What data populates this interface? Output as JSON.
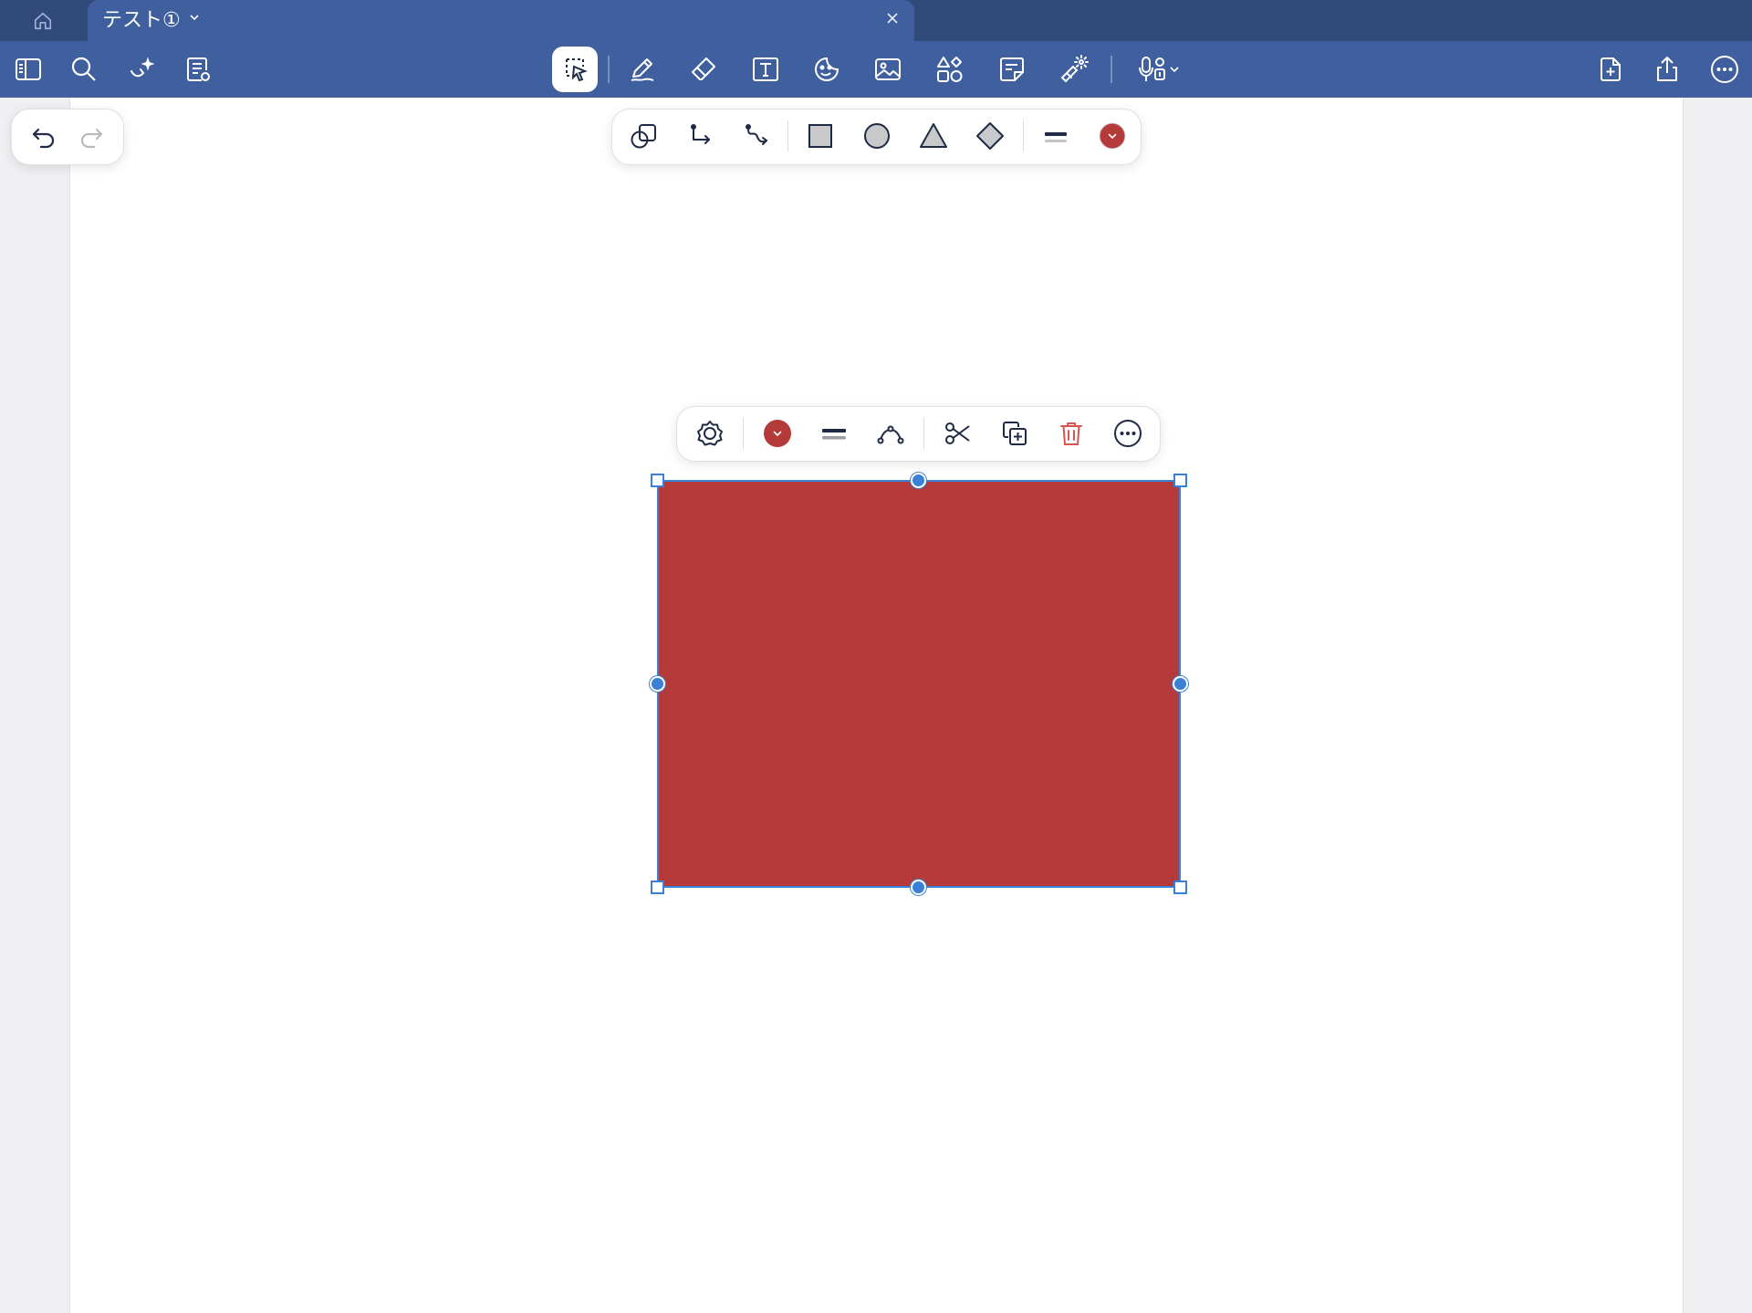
{
  "tab": {
    "title": "テスト①"
  },
  "colors": {
    "header_dark": "#32497b",
    "header": "#3f5f9e",
    "shape_fill": "#b53b3a",
    "selection": "#3a80d6",
    "delete": "#d9534f"
  },
  "toolbar": {
    "left": [
      "sidebar-icon",
      "search-icon",
      "ai-assist-icon",
      "note-settings-icon"
    ],
    "center": [
      "lasso-select-icon",
      "pen-icon",
      "eraser-icon",
      "text-box-icon",
      "sticker-icon",
      "image-icon",
      "shapes-icon",
      "sticky-note-icon",
      "laser-pointer-icon",
      "microphone-icon"
    ],
    "right": [
      "add-page-icon",
      "share-icon",
      "more-icon"
    ]
  },
  "shape_toolbar": {
    "tools": [
      "shape-recognition-icon",
      "elbow-connector-icon",
      "curved-connector-icon",
      "square-icon",
      "circle-icon",
      "triangle-icon",
      "diamond-icon",
      "line-weight-icon",
      "color-picker-icon"
    ],
    "selected_color": "#b53b3a"
  },
  "context_menu": {
    "items": [
      "shape-settings-icon",
      "fill-color-icon",
      "line-weight-icon",
      "edit-points-icon",
      "cut-icon",
      "duplicate-icon",
      "delete-icon",
      "more-icon"
    ]
  },
  "selected_shape": {
    "type": "rectangle",
    "fill": "#b53b3a"
  }
}
